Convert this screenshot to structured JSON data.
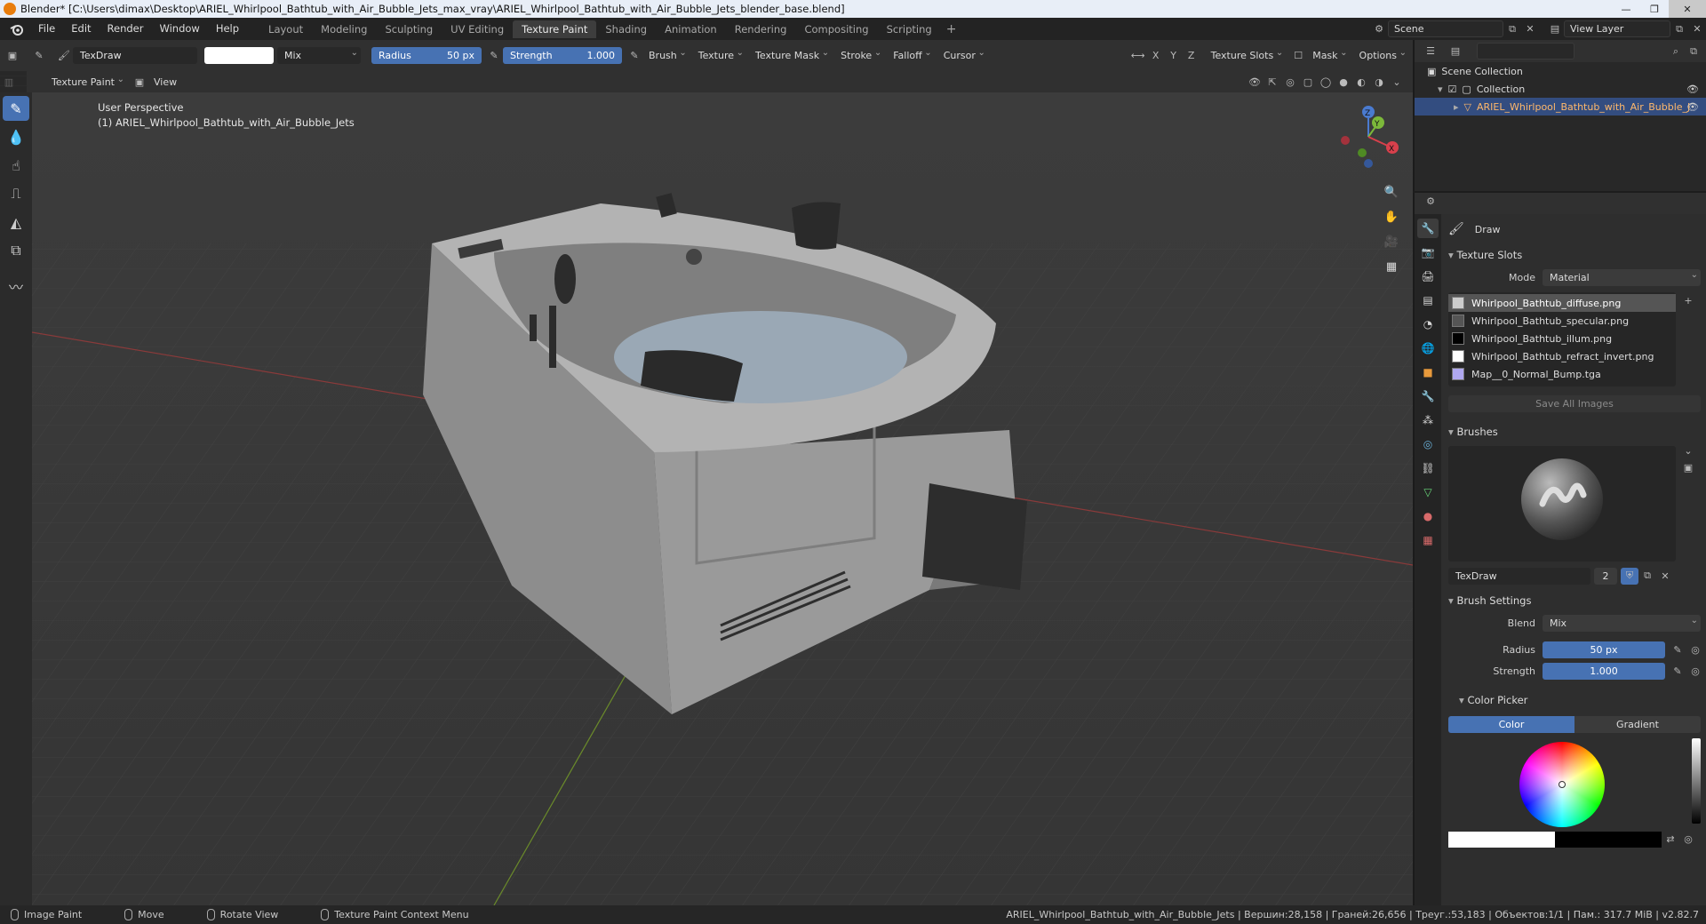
{
  "titlebar": {
    "title": "Blender* [C:\\Users\\dimax\\Desktop\\ARIEL_Whirlpool_Bathtub_with_Air_Bubble_Jets_max_vray\\ARIEL_Whirlpool_Bathtub_with_Air_Bubble_Jets_blender_base.blend]"
  },
  "menu": [
    "File",
    "Edit",
    "Render",
    "Window",
    "Help"
  ],
  "workspaces": [
    "Layout",
    "Modeling",
    "Sculpting",
    "UV Editing",
    "Texture Paint",
    "Shading",
    "Animation",
    "Rendering",
    "Compositing",
    "Scripting"
  ],
  "active_workspace": "Texture Paint",
  "scene": {
    "name": "Scene",
    "view_layer": "View Layer"
  },
  "toolheader": {
    "brush_name": "TexDraw",
    "blend": "Mix",
    "radius_label": "Radius",
    "radius_value": "50 px",
    "strength_label": "Strength",
    "strength_value": "1.000",
    "menus": [
      "Brush",
      "Texture",
      "Texture Mask",
      "Stroke",
      "Falloff",
      "Cursor"
    ],
    "axes": [
      "X",
      "Y",
      "Z"
    ],
    "right_menus": [
      "Texture Slots",
      "Mask",
      "Options"
    ]
  },
  "modeheader": {
    "mode": "Texture Paint",
    "view": "View"
  },
  "viewport": {
    "perspective": "User Perspective",
    "object_label": "(1) ARIEL_Whirlpool_Bathtub_with_Air_Bubble_Jets",
    "gizmo_axes": [
      "Z",
      "Y",
      "X"
    ]
  },
  "outliner": {
    "root": "Scene Collection",
    "collection": "Collection",
    "object": "ARIEL_Whirlpool_Bathtub_with_Air_Bubble_J"
  },
  "properties": {
    "tool_name": "Draw",
    "texture_slots_title": "Texture Slots",
    "mode_label": "Mode",
    "mode_value": "Material",
    "slots": [
      "Whirlpool_Bathtub_diffuse.png",
      "Whirlpool_Bathtub_specular.png",
      "Whirlpool_Bathtub_illum.png",
      "Whirlpool_Bathtub_refract_invert.png",
      "Map__0_Normal_Bump.tga"
    ],
    "save_all": "Save All Images",
    "brushes_title": "Brushes",
    "brush_name": "TexDraw",
    "brush_users": "2",
    "brush_settings_title": "Brush Settings",
    "blend_label": "Blend",
    "blend_value": "Mix",
    "radius_label": "Radius",
    "radius_value": "50 px",
    "strength_label": "Strength",
    "strength_value": "1.000",
    "color_picker_title": "Color Picker",
    "color_tab": "Color",
    "gradient_tab": "Gradient"
  },
  "statusbar": {
    "items": [
      "Image Paint",
      "Move",
      "Rotate View",
      "Texture Paint Context Menu"
    ],
    "stats": "ARIEL_Whirlpool_Bathtub_with_Air_Bubble_Jets | Вершин:28,158 | Граней:26,656 | Треуг.:53,183 | Объектов:1/1 | Пам.: 317.7 MiB | v2.82.7"
  },
  "colors": {
    "accent": "#4772b3",
    "header": "#303030",
    "panel": "#2e2e2e",
    "viewport": "#3a3a3a",
    "selected_object": "#ffb86a"
  }
}
